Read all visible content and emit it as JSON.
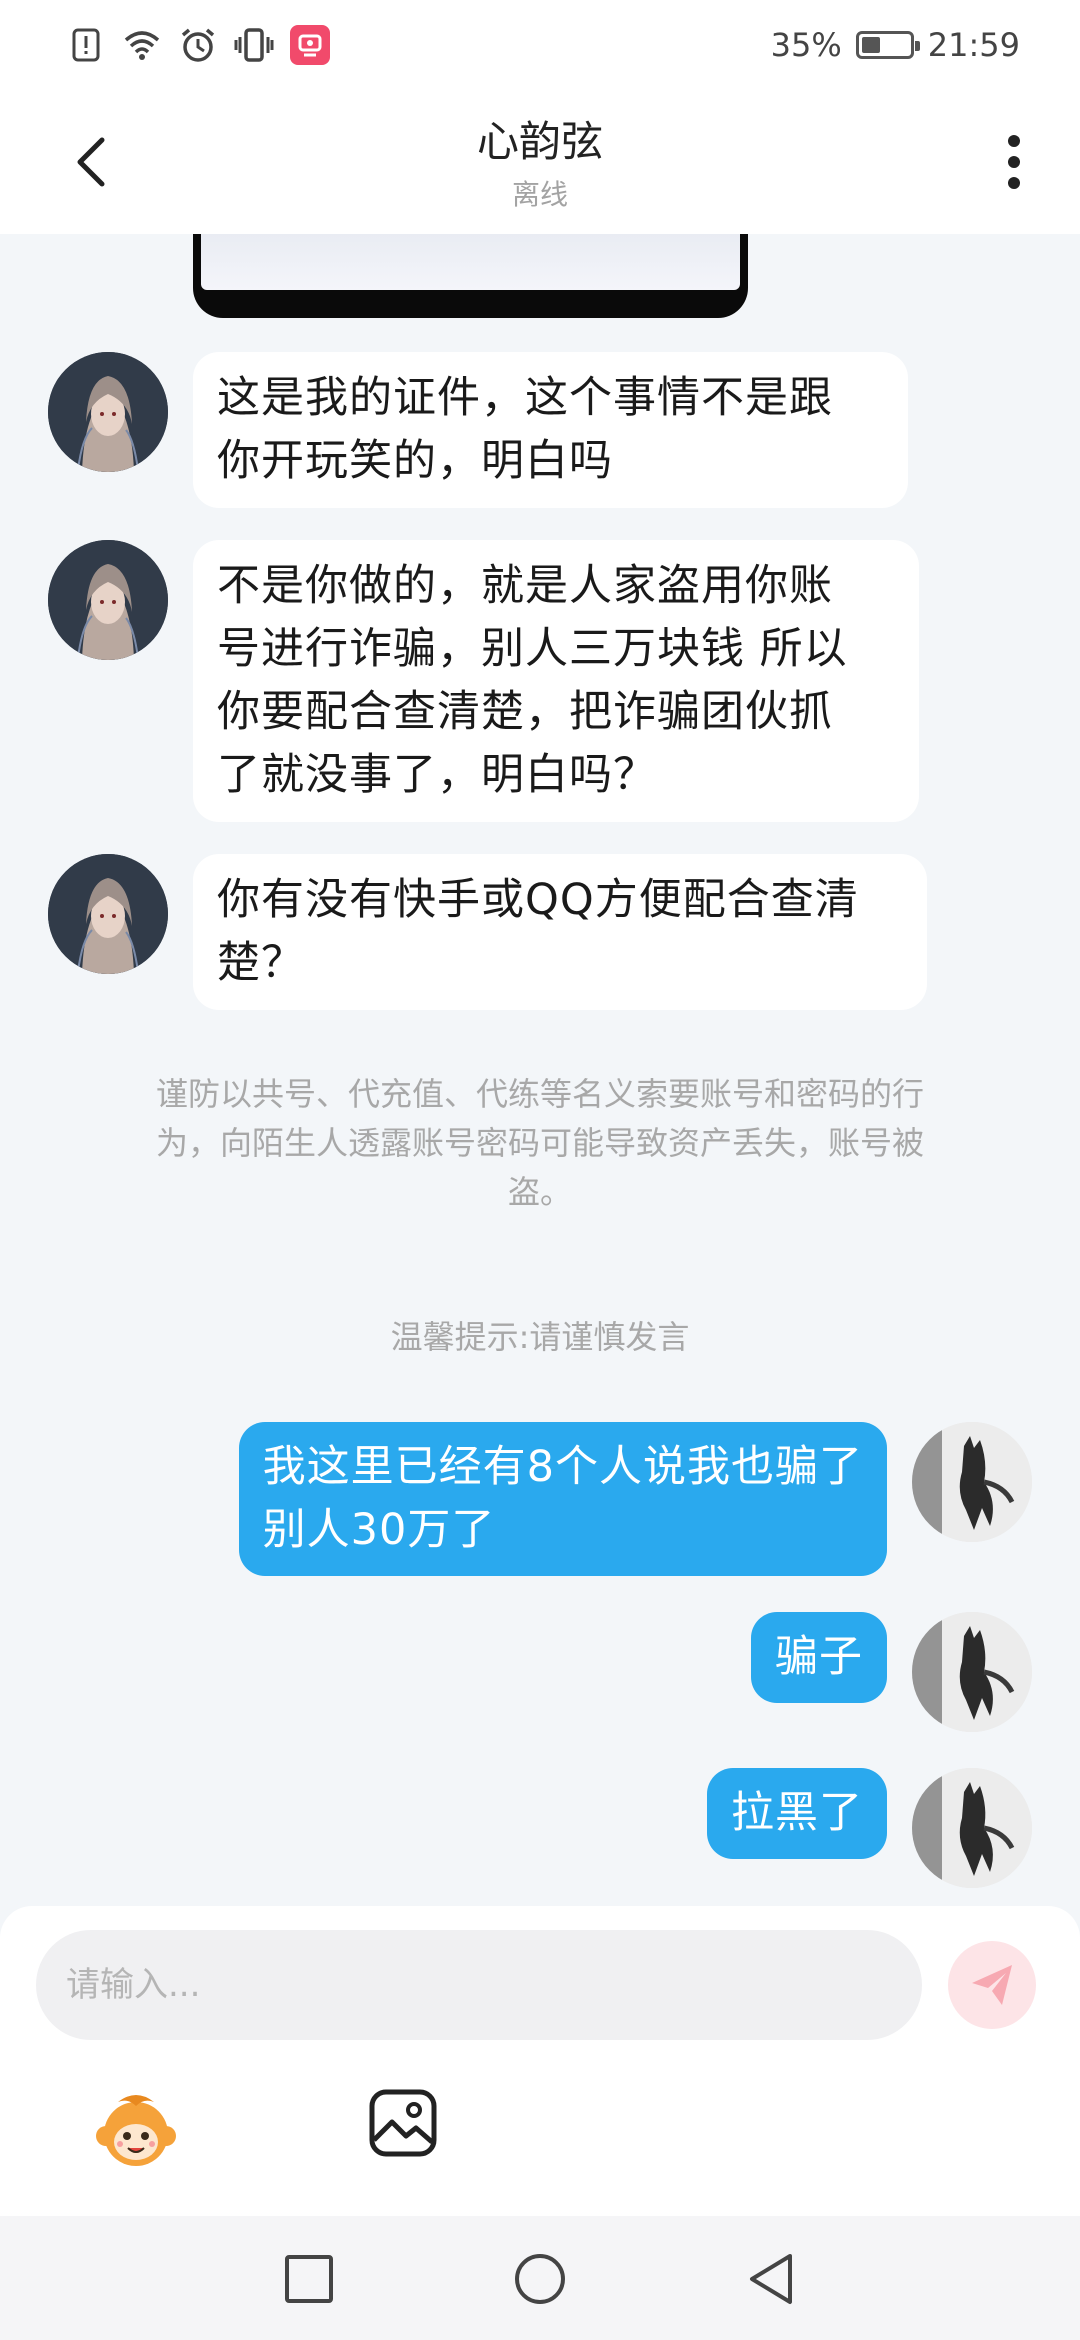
{
  "status_bar": {
    "battery_text": "35%",
    "battery_level": 0.35,
    "time": "21:59",
    "icons": [
      "alert-icon",
      "wifi-icon",
      "alarm-icon",
      "vibrate-icon",
      "app-notification-icon"
    ]
  },
  "header": {
    "title": "心韵弦",
    "subtitle": "离线"
  },
  "messages": [
    {
      "side": "in",
      "lines": [
        "这是我的证件，这个事情不是跟",
        "你开玩笑的，明白吗"
      ]
    },
    {
      "side": "in",
      "lines": [
        "不是你做的，就是人家盗用你账",
        "号进行诈骗，别人三万块钱 所以",
        "你要配合查清楚，把诈骗团伙抓",
        "了就没事了，明白吗？"
      ]
    },
    {
      "side": "in",
      "lines": [
        "你有没有快手或QQ方便配合查清",
        "楚？"
      ]
    },
    {
      "side": "out",
      "lines": [
        "我这里已经有8个人说我也骗了",
        "别人30万了"
      ]
    },
    {
      "side": "out",
      "lines": [
        "骗子"
      ]
    },
    {
      "side": "out",
      "lines": [
        "拉黑了"
      ]
    }
  ],
  "notice_lines": [
    "谨防以共号、代充值、代练等名义索要账号和密码的行",
    "为，向陌生人透露账号密码可能导致资产丢失，账号被",
    "盗。"
  ],
  "tip": "温馨提示:请谨慎发言",
  "input": {
    "placeholder": "请输入...",
    "value": ""
  },
  "colors": {
    "outgoing_bubble": "#2aa9ee",
    "incoming_bubble": "#ffffff",
    "chat_background": "#f3f6f9",
    "send_button": "#fde4e7",
    "send_icon": "#f7a9b2"
  }
}
